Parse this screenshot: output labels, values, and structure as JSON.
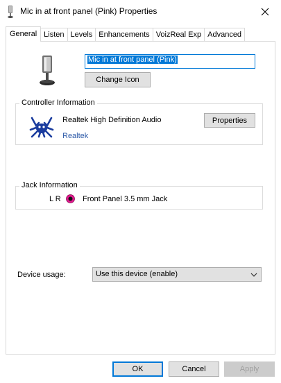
{
  "window": {
    "title": "Mic in at front panel (Pink) Properties"
  },
  "tabs": [
    {
      "label": "General",
      "active": true
    },
    {
      "label": "Listen",
      "active": false
    },
    {
      "label": "Levels",
      "active": false
    },
    {
      "label": "Enhancements",
      "active": false
    },
    {
      "label": "VoizReal Exp",
      "active": false
    },
    {
      "label": "Advanced",
      "active": false
    }
  ],
  "general": {
    "device_name": "Mic in at front panel (Pink)",
    "change_icon_label": "Change Icon",
    "controller": {
      "group_label": "Controller Information",
      "name": "Realtek High Definition Audio",
      "vendor_link": "Realtek",
      "properties_label": "Properties"
    },
    "jack": {
      "group_label": "Jack Information",
      "channels": "L R",
      "description": "Front Panel 3.5 mm Jack",
      "jack_color": "#e0198e"
    },
    "usage": {
      "label": "Device usage:",
      "selected": "Use this device (enable)"
    }
  },
  "buttons": {
    "ok": "OK",
    "cancel": "Cancel",
    "apply": "Apply"
  },
  "icons": {
    "title": "microphone-icon",
    "device": "microphone-icon",
    "vendor_logo": "realtek-crab-logo",
    "close": "close-icon",
    "dropdown": "chevron-down-icon",
    "jack": "jack-dot-icon"
  },
  "colors": {
    "accent": "#0078d7",
    "link": "#2d5aa8",
    "realtek_blue": "#1a3c9e"
  }
}
